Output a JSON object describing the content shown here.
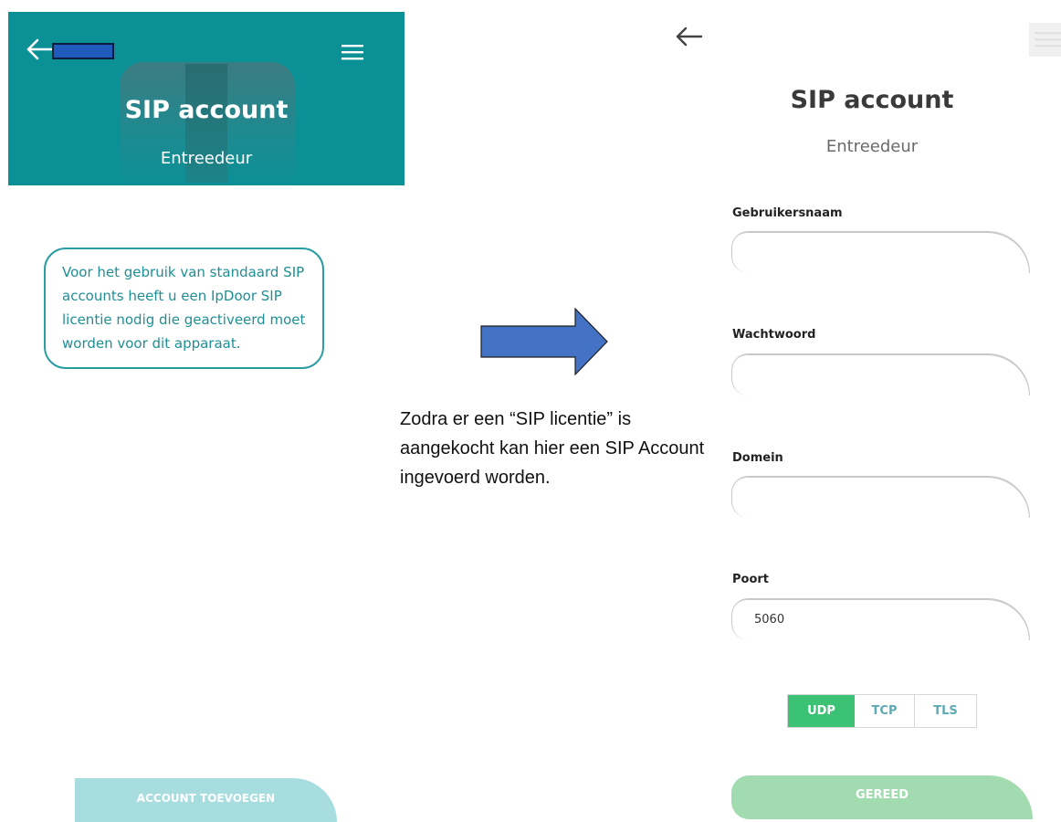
{
  "left_screen": {
    "title": "SIP account",
    "subtitle": "Entreedeur",
    "info_message": "Voor het gebruik van standaard SIP accounts heeft u een IpDoor SIP licentie nodig die geactiveerd moet worden voor dit apparaat.",
    "add_account_label": "ACCOUNT TOEVOEGEN",
    "icons": {
      "back": "back-arrow-icon",
      "menu": "hamburger-menu-icon"
    }
  },
  "annotation": {
    "text": "Zodra er een “SIP licentie” is aangekocht kan hier een SIP Account ingevoerd worden.",
    "arrow_color": "#4472c4"
  },
  "right_screen": {
    "title": "SIP account",
    "subtitle": "Entreedeur",
    "fields": {
      "username": {
        "label": "Gebruikersnaam",
        "value": ""
      },
      "password": {
        "label": "Wachtwoord",
        "value": ""
      },
      "domain": {
        "label": "Domein",
        "value": ""
      },
      "port": {
        "label": "Poort",
        "value": "5060"
      }
    },
    "transport": {
      "options": [
        "UDP",
        "TCP",
        "TLS"
      ],
      "selected": "UDP"
    },
    "done_label": "GEREED"
  },
  "colors": {
    "header_teal": "#0b9096",
    "info_text": "#1e8f95",
    "add_button": "#a8dde0",
    "transport_active": "#3bc275",
    "done_button": "#a3dbb0"
  }
}
